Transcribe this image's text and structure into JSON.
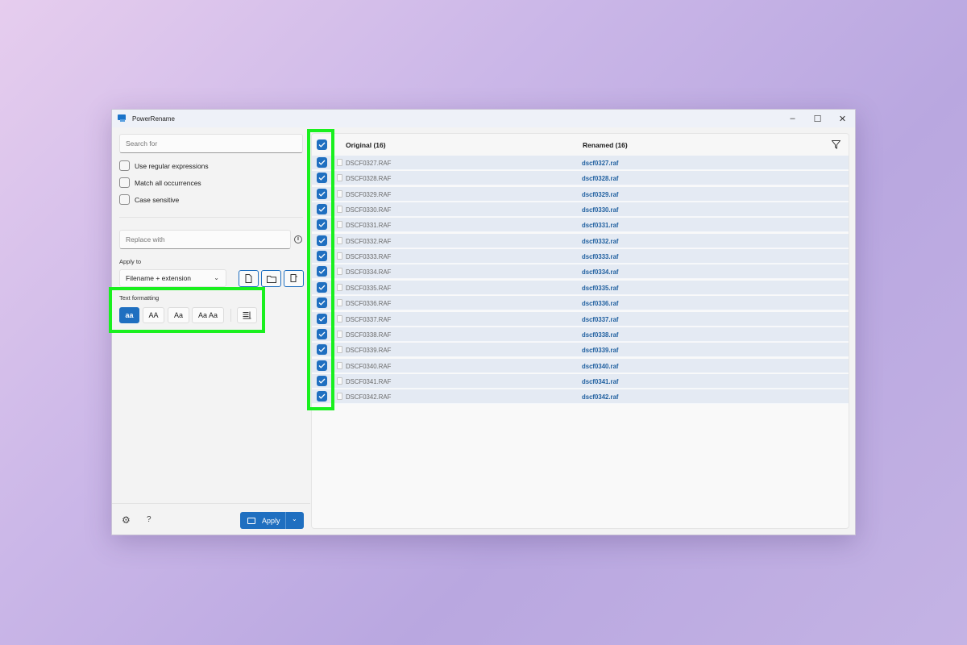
{
  "window": {
    "title": "PowerRename",
    "controls": [
      "–",
      "☐",
      "✕"
    ]
  },
  "search": {
    "placeholder": "Search for"
  },
  "options": [
    {
      "label": "Use regular expressions"
    },
    {
      "label": "Match all occurrences"
    },
    {
      "label": "Case sensitive"
    }
  ],
  "replace": {
    "placeholder": "Replace with",
    "info_icon": "i"
  },
  "apply_to": {
    "label": "Apply to",
    "value": "Filename + extension"
  },
  "text_formatting": {
    "label": "Text formatting",
    "buttons": [
      "aa",
      "AA",
      "Aa",
      "Aa Aa"
    ],
    "active": "aa"
  },
  "footer": {
    "apply_label": "Apply",
    "help_label": "?"
  },
  "list": {
    "original_header": "Original (16)",
    "renamed_header": "Renamed (16)",
    "rows": [
      {
        "original": "DSCF0327.RAF",
        "renamed": "dscf0327.raf"
      },
      {
        "original": "DSCF0328.RAF",
        "renamed": "dscf0328.raf"
      },
      {
        "original": "DSCF0329.RAF",
        "renamed": "dscf0329.raf"
      },
      {
        "original": "DSCF0330.RAF",
        "renamed": "dscf0330.raf"
      },
      {
        "original": "DSCF0331.RAF",
        "renamed": "dscf0331.raf"
      },
      {
        "original": "DSCF0332.RAF",
        "renamed": "dscf0332.raf"
      },
      {
        "original": "DSCF0333.RAF",
        "renamed": "dscf0333.raf"
      },
      {
        "original": "DSCF0334.RAF",
        "renamed": "dscf0334.raf"
      },
      {
        "original": "DSCF0335.RAF",
        "renamed": "dscf0335.raf"
      },
      {
        "original": "DSCF0336.RAF",
        "renamed": "dscf0336.raf"
      },
      {
        "original": "DSCF0337.RAF",
        "renamed": "dscf0337.raf"
      },
      {
        "original": "DSCF0338.RAF",
        "renamed": "dscf0338.raf"
      },
      {
        "original": "DSCF0339.RAF",
        "renamed": "dscf0339.raf"
      },
      {
        "original": "DSCF0340.RAF",
        "renamed": "dscf0340.raf"
      },
      {
        "original": "DSCF0341.RAF",
        "renamed": "dscf0341.raf"
      },
      {
        "original": "DSCF0342.RAF",
        "renamed": "dscf0342.raf"
      }
    ]
  },
  "colors": {
    "accent": "#1f6fc0",
    "highlight": "#19f01e",
    "renamed_text": "#1f5f9f"
  }
}
